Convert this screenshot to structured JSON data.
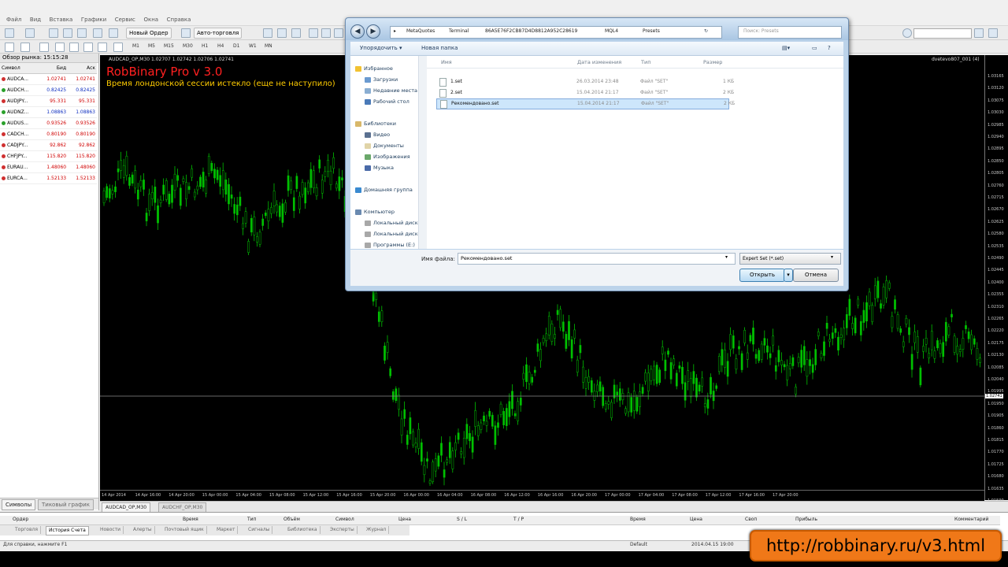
{
  "menu": [
    "Файл",
    "Вид",
    "Вставка",
    "Графики",
    "Сервис",
    "Окна",
    "Справка"
  ],
  "toolbar": {
    "new_order": "Новый Ордер",
    "auto_trading": "Авто-торговля",
    "timeframes": [
      "M1",
      "M5",
      "M15",
      "M30",
      "H1",
      "H4",
      "D1",
      "W1",
      "MN"
    ]
  },
  "market_watch": {
    "title": "Обзор рынка: 15:15:28",
    "headers": {
      "symbol": "Символ",
      "bid": "Бид",
      "ask": "Аск"
    },
    "rows": [
      {
        "symbol": "AUDCA...",
        "bid": "1.02741",
        "ask": "1.02741",
        "dot": "#d03030"
      },
      {
        "symbol": "AUDCH...",
        "bid": "0.82425",
        "ask": "0.82425",
        "dot": "#2aa02a"
      },
      {
        "symbol": "AUDJPY...",
        "bid": "95.331",
        "ask": "95.331",
        "dot": "#d03030"
      },
      {
        "symbol": "AUDNZ...",
        "bid": "1.08863",
        "ask": "1.08863",
        "dot": "#2aa02a"
      },
      {
        "symbol": "AUDUS...",
        "bid": "0.93526",
        "ask": "0.93526",
        "dot": "#2aa02a"
      },
      {
        "symbol": "CADCH...",
        "bid": "0.80190",
        "ask": "0.80190",
        "dot": "#d03030"
      },
      {
        "symbol": "CADJPY...",
        "bid": "92.862",
        "ask": "92.862",
        "dot": "#d03030"
      },
      {
        "symbol": "CHFJPY...",
        "bid": "115.820",
        "ask": "115.820",
        "dot": "#d03030"
      },
      {
        "symbol": "EURAU...",
        "bid": "1.48060",
        "ask": "1.48060",
        "dot": "#d03030"
      },
      {
        "symbol": "EURCA...",
        "bid": "1.52133",
        "ask": "1.52133",
        "dot": "#d03030"
      }
    ],
    "tabs": [
      "Символы",
      "Тиковый график"
    ]
  },
  "chart": {
    "header": "AUDCAD_OP,M30  1.02707 1.02742 1.02706 1.02741",
    "indicator_title": "RobBinary Pro v 3.0",
    "indicator_message": "Время лондонской сессии истекло (еще не наступило)",
    "right_label": "dvetevo807_001 (4)",
    "current_price": "1.02741",
    "price_labels": [
      "1.03165",
      "1.03120",
      "1.03075",
      "1.03030",
      "1.02985",
      "1.02940",
      "1.02895",
      "1.02850",
      "1.02805",
      "1.02760",
      "1.02715",
      "1.02670",
      "1.02625",
      "1.02580",
      "1.02535",
      "1.02490",
      "1.02445",
      "1.02400",
      "1.02355",
      "1.02310",
      "1.02265",
      "1.02220",
      "1.02175",
      "1.02130",
      "1.02085",
      "1.02040",
      "1.01995",
      "1.01950",
      "1.01905",
      "1.01860",
      "1.01815",
      "1.01770",
      "1.01725",
      "1.01680",
      "1.01635",
      "1.01590"
    ],
    "time_labels": [
      "14 Apr 2014",
      "14 Apr 16:00",
      "14 Apr 20:00",
      "15 Apr 00:00",
      "15 Apr 04:00",
      "15 Apr 08:00",
      "15 Apr 12:00",
      "15 Apr 16:00",
      "15 Apr 20:00",
      "16 Apr 00:00",
      "16 Apr 04:00",
      "16 Apr 08:00",
      "16 Apr 12:00",
      "16 Apr 16:00",
      "16 Apr 20:00",
      "17 Apr 00:00",
      "17 Apr 04:00",
      "17 Apr 08:00",
      "17 Apr 12:00",
      "17 Apr 16:00",
      "17 Apr 20:00"
    ],
    "tabs": [
      "AUDCAD_OP,M30",
      "AUDCHF_OP,M30"
    ]
  },
  "terminal": {
    "headers": [
      "Ордер",
      "Время",
      "Тип",
      "Объём",
      "Символ",
      "Цена",
      "S / L",
      "T / P",
      "Время",
      "Цена",
      "Своп",
      "Прибыль",
      "Комментарий"
    ],
    "tabs": [
      "Торговля",
      "История Счета",
      "Новости",
      "Алерты",
      "Почтовый ящик",
      "Маркет",
      "Сигналы",
      "Библиотека",
      "Эксперты",
      "Журнал"
    ]
  },
  "status": {
    "help": "Для справки, нажмите F1",
    "profile": "Default",
    "time": "2014.04.15 19:00"
  },
  "url_badge": "http://robbinary.ru/v3.html",
  "dialog": {
    "breadcrumb": [
      "MetaQuotes",
      "Terminal",
      "86A5E76F2CB87D4D8812A952C28619",
      "MQL4",
      "Presets"
    ],
    "search_placeholder": "Поиск: Presets",
    "toolbar": {
      "organize": "Упорядочить ▾",
      "new_folder": "Новая папка"
    },
    "nav": {
      "favorites": "Избранное",
      "downloads": "Загрузки",
      "recent": "Недавние места",
      "desktop": "Рабочий стол",
      "libraries": "Библиотеки",
      "video": "Видео",
      "documents": "Документы",
      "images": "Изображения",
      "music": "Музыка",
      "homegroup": "Домашняя группа",
      "computer": "Компьютер",
      "disk_c": "Локальный диск",
      "disk_d": "Локальный диск",
      "programs": "Программы (E:)"
    },
    "columns": {
      "name": "Имя",
      "date": "Дата изменения",
      "type": "Тип",
      "size": "Размер"
    },
    "files": [
      {
        "name": "1.set",
        "date": "26.03.2014 23:48",
        "type": "Файл \"SET\"",
        "size": "1 КБ"
      },
      {
        "name": "2.set",
        "date": "15.04.2014 21:17",
        "type": "Файл \"SET\"",
        "size": "2 КБ"
      },
      {
        "name": "Рекомендовано.set",
        "date": "15.04.2014 21:17",
        "type": "Файл \"SET\"",
        "size": "2 КБ"
      }
    ],
    "filename_label": "Имя файла:",
    "filename_value": "Рекомендовано.set",
    "filetype": "Expert Set (*.set)",
    "open_label": "Открыть",
    "cancel_label": "Отмена"
  },
  "colors": {
    "candle": "#00c000",
    "title": "#ff2020",
    "message": "#ffcc00",
    "badge": "#f07818"
  }
}
